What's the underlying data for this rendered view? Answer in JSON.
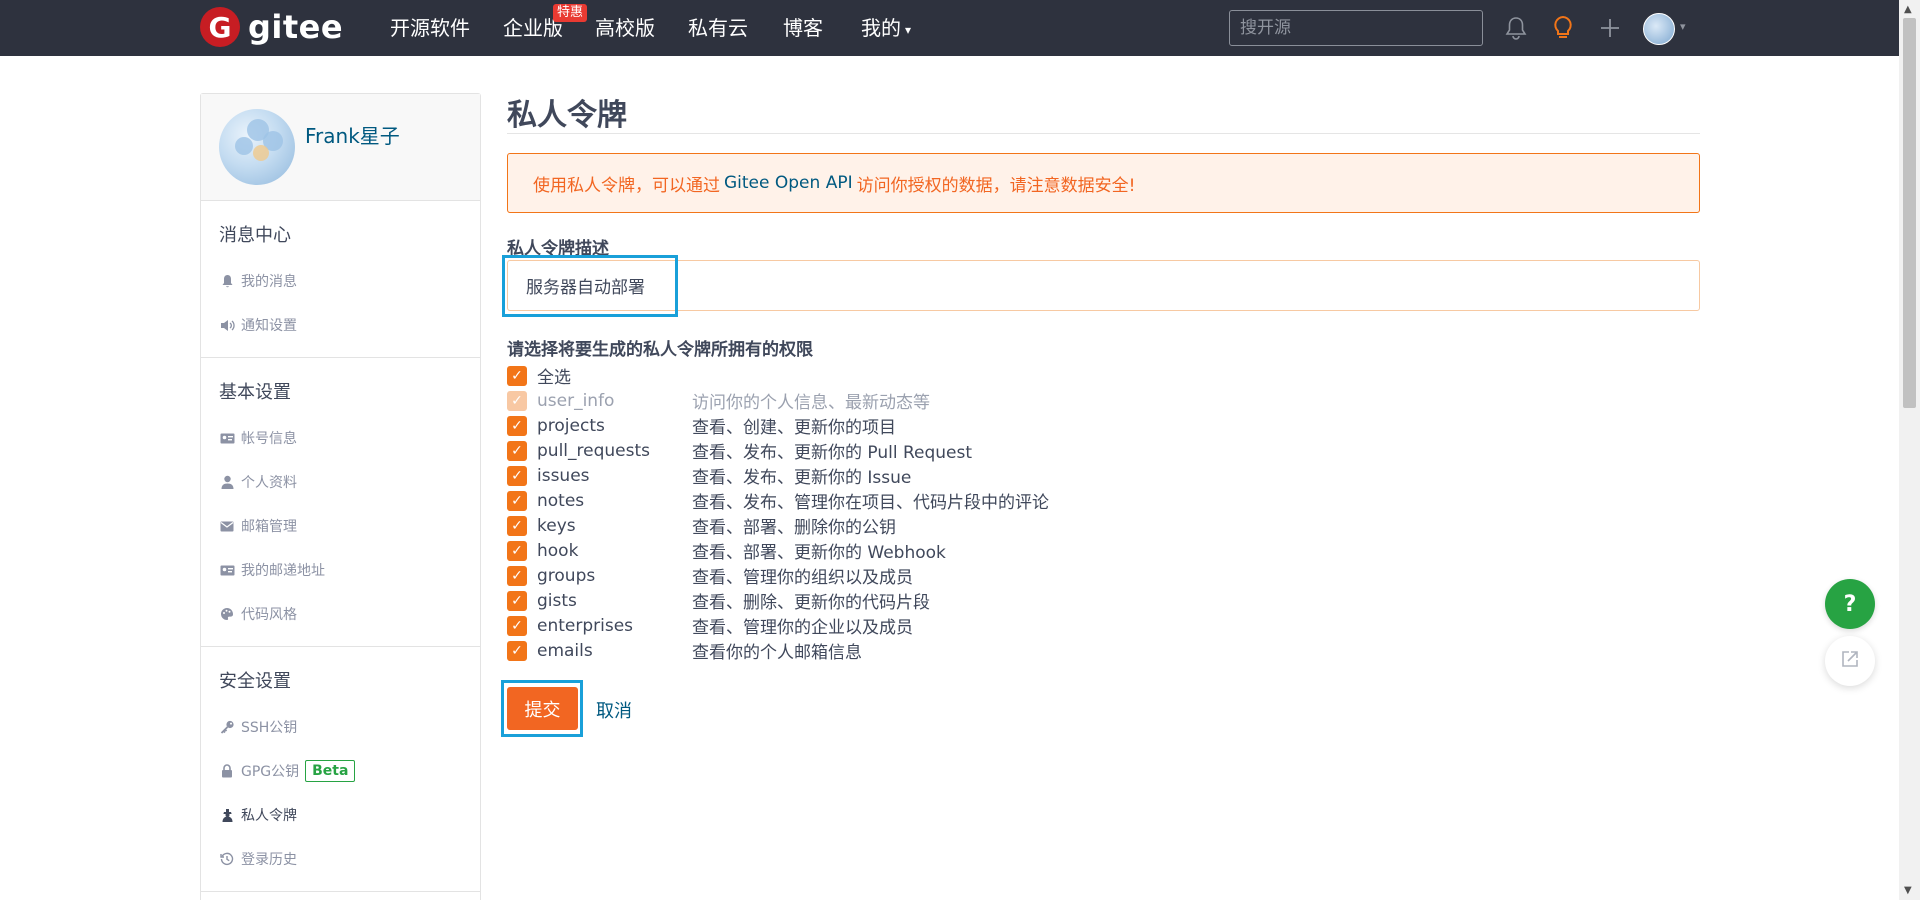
{
  "nav": {
    "logo_letter": "G",
    "logo_text": "gitee",
    "items": [
      "开源软件",
      "企业版",
      "高校版",
      "私有云",
      "博客",
      "我的"
    ],
    "badge": "特惠",
    "search_placeholder": "搜开源",
    "icons": [
      "bell-icon",
      "lightbulb-icon",
      "plus-icon",
      "avatar"
    ]
  },
  "sidebar": {
    "user_name": "Frank星子",
    "sections": [
      {
        "title": "消息中心",
        "items": [
          {
            "label": "我的消息",
            "icon": "bell-icon"
          },
          {
            "label": "通知设置",
            "icon": "speaker-icon"
          }
        ]
      },
      {
        "title": "基本设置",
        "items": [
          {
            "label": "帐号信息",
            "icon": "id-card-icon"
          },
          {
            "label": "个人资料",
            "icon": "user-icon"
          },
          {
            "label": "邮箱管理",
            "icon": "envelope-icon"
          },
          {
            "label": "我的邮递地址",
            "icon": "address-card-icon"
          },
          {
            "label": "代码风格",
            "icon": "palette-icon"
          }
        ]
      },
      {
        "title": "安全设置",
        "items": [
          {
            "label": "SSH公钥",
            "icon": "key-icon"
          },
          {
            "label": "GPG公钥",
            "icon": "lock-icon",
            "badge": "Beta"
          },
          {
            "label": "私人令牌",
            "icon": "token-icon",
            "active": true
          },
          {
            "label": "登录历史",
            "icon": "history-icon"
          }
        ]
      }
    ]
  },
  "main": {
    "title": "私人令牌",
    "notice_prefix": "使用私人令牌，可以通过",
    "notice_api": "Gitee Open API",
    "notice_suffix": "访问你授权的数据，请注意数据安全!",
    "desc_label": "私人令牌描述",
    "desc_value": "服务器自动部署",
    "perm_label": "请选择将要生成的私人令牌所拥有的权限",
    "select_all": "全选",
    "permissions": [
      {
        "name": "user_info",
        "desc": "访问你的个人信息、最新动态等",
        "checked": true,
        "disabled": true
      },
      {
        "name": "projects",
        "desc": "查看、创建、更新你的项目",
        "checked": true
      },
      {
        "name": "pull_requests",
        "desc": "查看、发布、更新你的 Pull Request",
        "checked": true
      },
      {
        "name": "issues",
        "desc": "查看、发布、更新你的 Issue",
        "checked": true
      },
      {
        "name": "notes",
        "desc": "查看、发布、管理你在项目、代码片段中的评论",
        "checked": true
      },
      {
        "name": "keys",
        "desc": "查看、部署、删除你的公钥",
        "checked": true
      },
      {
        "name": "hook",
        "desc": "查看、部署、更新你的 Webhook",
        "checked": true
      },
      {
        "name": "groups",
        "desc": "查看、管理你的组织以及成员",
        "checked": true
      },
      {
        "name": "gists",
        "desc": "查看、删除、更新你的代码片段",
        "checked": true
      },
      {
        "name": "enterprises",
        "desc": "查看、管理你的企业以及成员",
        "checked": true
      },
      {
        "name": "emails",
        "desc": "查看你的个人邮箱信息",
        "checked": true
      }
    ],
    "submit_label": "提交",
    "cancel_label": "取消"
  },
  "floating": {
    "help_label": "?"
  },
  "colors": {
    "navbar": "#2e323e",
    "brand": "#c71d23",
    "accent": "#f26622",
    "link": "#005980",
    "focus": "#19a0d9",
    "help": "#27a343"
  }
}
